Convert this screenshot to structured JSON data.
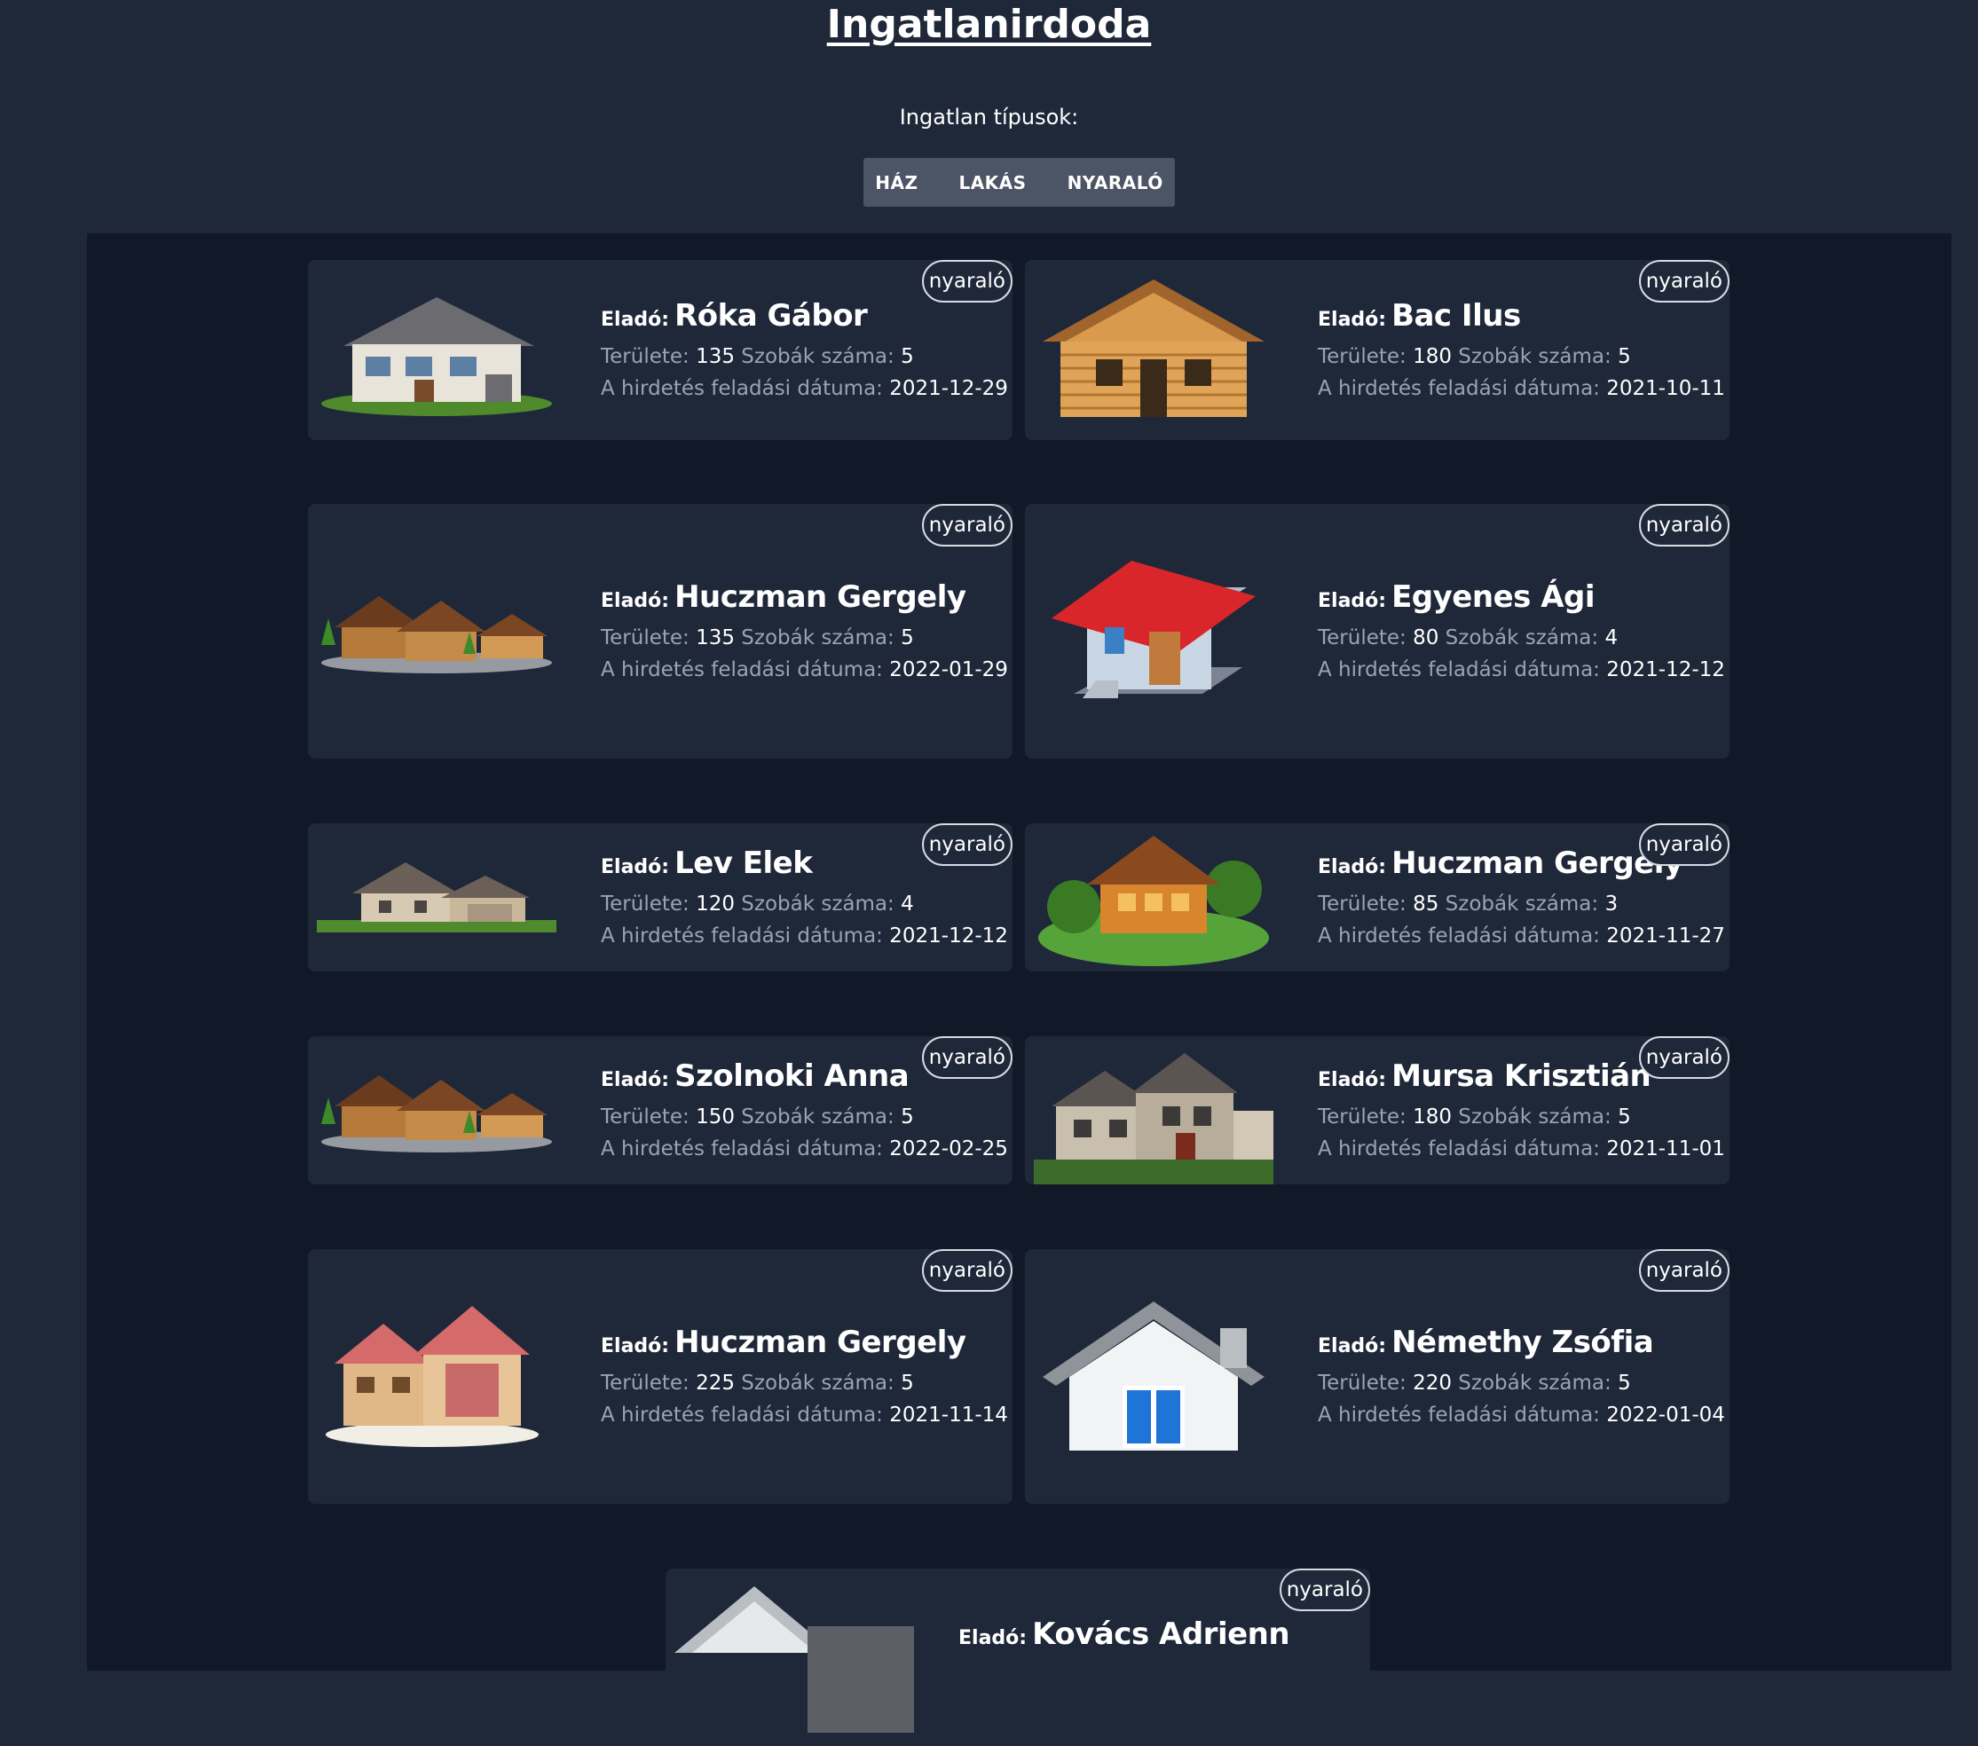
{
  "header": {
    "title": "Ingatlanirdoda",
    "types_label": "Ingatlan típusok:"
  },
  "filters": [
    {
      "label": "HÁZ"
    },
    {
      "label": "LAKÁS"
    },
    {
      "label": "NYARALÓ"
    }
  ],
  "labels": {
    "seller": "Eladó:",
    "area": "Területe:",
    "rooms": "Szobák száma:",
    "date": "A hirdetés feladási dátuma:"
  },
  "listings": [
    {
      "seller": "Róka Gábor",
      "area": "135",
      "rooms": "5",
      "date": "2021-12-29",
      "badge": "nyaraló",
      "icon": "modern-house-icon"
    },
    {
      "seller": "Bac Ilus",
      "area": "180",
      "rooms": "5",
      "date": "2021-10-11",
      "badge": "nyaraló",
      "icon": "log-cabin-icon"
    },
    {
      "seller": "Huczman Gergely",
      "area": "135",
      "rooms": "5",
      "date": "2022-01-29",
      "badge": "nyaraló",
      "icon": "wooden-houses-icon"
    },
    {
      "seller": "Egyenes Ági",
      "area": "80",
      "rooms": "4",
      "date": "2021-12-12",
      "badge": "nyaraló",
      "icon": "red-roof-house-icon"
    },
    {
      "seller": "Lev Elek",
      "area": "120",
      "rooms": "4",
      "date": "2021-12-12",
      "badge": "nyaraló",
      "icon": "suburban-house-icon"
    },
    {
      "seller": "Huczman Gergely",
      "area": "85",
      "rooms": "3",
      "date": "2021-11-27",
      "badge": "nyaraló",
      "icon": "cottage-on-grass-icon"
    },
    {
      "seller": "Szolnoki Anna",
      "area": "150",
      "rooms": "5",
      "date": "2022-02-25",
      "badge": "nyaraló",
      "icon": "wooden-houses-icon"
    },
    {
      "seller": "Mursa Krisztián",
      "area": "180",
      "rooms": "5",
      "date": "2021-11-01",
      "badge": "nyaraló",
      "icon": "stone-house-icon"
    },
    {
      "seller": "Huczman Gergely",
      "area": "225",
      "rooms": "5",
      "date": "2021-11-14",
      "badge": "nyaraló",
      "icon": "chalet-house-icon"
    },
    {
      "seller": "Némethy Zsófia",
      "area": "220",
      "rooms": "5",
      "date": "2022-01-04",
      "badge": "nyaraló",
      "icon": "white-house-icon"
    },
    {
      "seller": "Kovács Adrienn",
      "area": "",
      "rooms": "",
      "date": "",
      "badge": "nyaraló",
      "icon": "grey-house-icon"
    }
  ],
  "colors": {
    "page_bg": "#1f2839",
    "main_bg": "#111827",
    "card_bg": "#1f2839",
    "filter_bg": "#4b5565",
    "muted_text": "#9aa3b1"
  }
}
